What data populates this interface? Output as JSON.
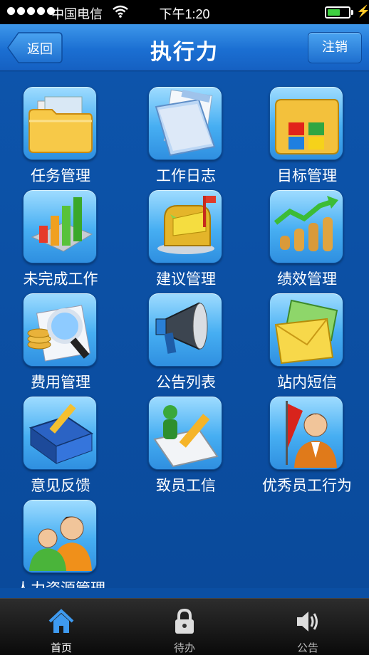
{
  "status_bar": {
    "carrier": "中国电信",
    "time": "下午1:20",
    "charge_symbol": "⚡",
    "battery_level": 0.6
  },
  "header": {
    "title": "执行力",
    "back_label": "返回",
    "logout_label": "注销",
    "accent_color": "#1b6fd2"
  },
  "modules": [
    {
      "label": "任务管理",
      "icon": "folder-icon"
    },
    {
      "label": "工作日志",
      "icon": "document-icon"
    },
    {
      "label": "目标管理",
      "icon": "folder-grid-icon"
    },
    {
      "label": "未完成工作",
      "icon": "bar-chart-icon"
    },
    {
      "label": "建议管理",
      "icon": "mailbox-icon"
    },
    {
      "label": "绩效管理",
      "icon": "coins-growth-icon"
    },
    {
      "label": "费用管理",
      "icon": "magnifier-coins-icon"
    },
    {
      "label": "公告列表",
      "icon": "megaphone-icon"
    },
    {
      "label": "站内短信",
      "icon": "envelope-icon"
    },
    {
      "label": "意见反馈",
      "icon": "binder-pencil-icon"
    },
    {
      "label": "致员工信",
      "icon": "letter-person-icon"
    },
    {
      "label": "优秀员工行为",
      "icon": "employee-flag-icon"
    },
    {
      "label": "人力资源管理",
      "icon": "people-icon"
    }
  ],
  "tab_bar": {
    "tabs": [
      {
        "label": "首页",
        "icon": "home-icon",
        "active": true
      },
      {
        "label": "待办",
        "icon": "lock-icon",
        "active": false
      },
      {
        "label": "公告",
        "icon": "speaker-icon",
        "active": false
      }
    ]
  }
}
